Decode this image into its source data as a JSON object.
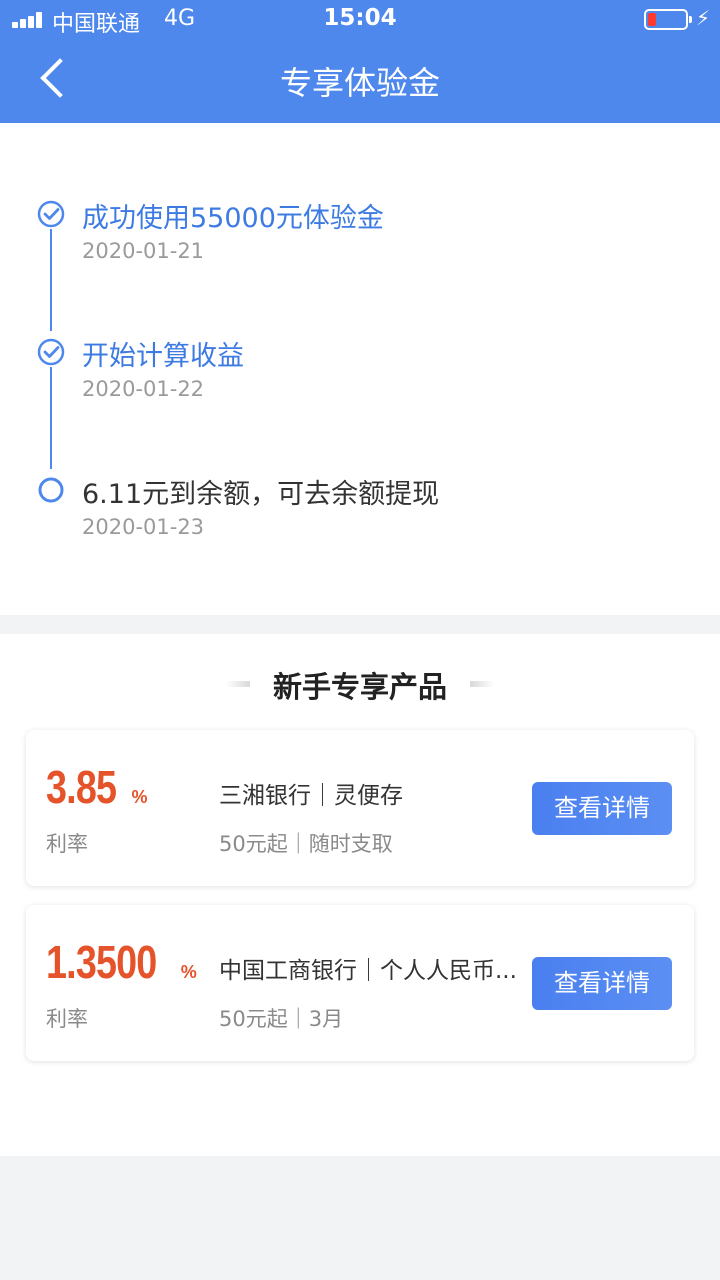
{
  "status_bar": {
    "carrier": "中国联通",
    "network": "4G",
    "time": "15:04",
    "battery_level": 0.15,
    "charging_glyph": "⚡"
  },
  "nav": {
    "title": "专享体验金",
    "back_icon": "chevron-left-icon"
  },
  "timeline": [
    {
      "title": "成功使用55000元体验金",
      "date": "2020-01-21",
      "status": "done"
    },
    {
      "title": "开始计算收益",
      "date": "2020-01-22",
      "status": "done"
    },
    {
      "title": "6.11元到余额，可去余额提现",
      "date": "2020-01-23",
      "status": "pending"
    }
  ],
  "products_section": {
    "title": "新手专享产品"
  },
  "products": [
    {
      "rate": "3.85",
      "rate_unit": "%",
      "rate_label": "利率",
      "name": "三湘银行｜灵便存",
      "desc": "50元起｜随时支取",
      "button": "查看详情"
    },
    {
      "rate": "1.3500",
      "rate_unit": "%",
      "rate_label": "利率",
      "name": "中国工商银行｜个人人民币...",
      "desc": "50元起｜3月",
      "button": "查看详情"
    }
  ],
  "colors": {
    "primary": "#4e88ec",
    "rate": "#e5532a",
    "active_text": "#3d7be3"
  }
}
